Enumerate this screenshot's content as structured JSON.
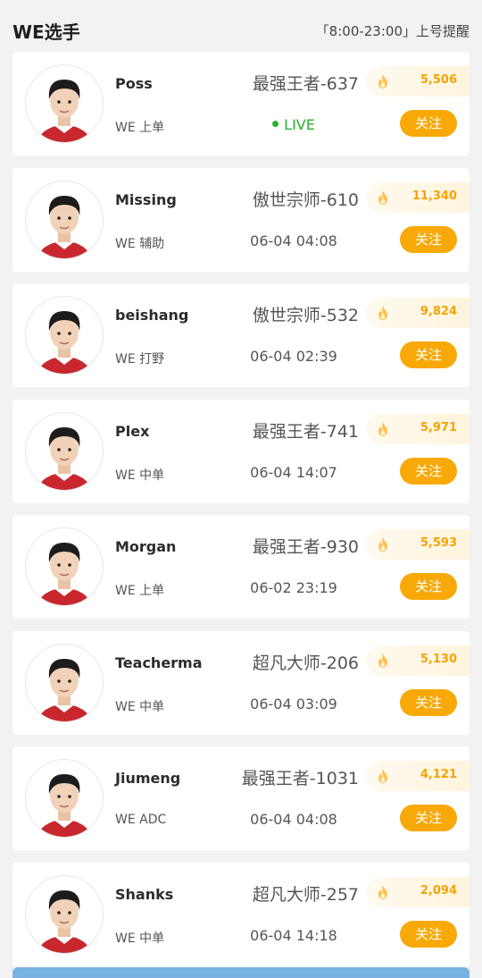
{
  "header": {
    "title": "WE选手",
    "reminder": "「8:00-23:00」上号提醒"
  },
  "colors": {
    "accent": "#f8a908",
    "live": "#27b12c",
    "heat_text": "#f5a300",
    "jersey": "#c8272e",
    "bottom_strip": "#7ab2e3"
  },
  "players": [
    {
      "name": "Poss",
      "team_role": "WE 上单",
      "rank": "最强王者-637",
      "status": "LIVE",
      "live": true,
      "heat": "5,506",
      "follow_label": "关注",
      "avatar_icon": "player-avatar-icon",
      "flame_icon": "flame-icon"
    },
    {
      "name": "Missing",
      "team_role": "WE 辅助",
      "rank": "傲世宗师-610",
      "status": "06-04 04:08",
      "live": false,
      "heat": "11,340",
      "follow_label": "关注",
      "avatar_icon": "player-avatar-icon",
      "flame_icon": "flame-icon"
    },
    {
      "name": "beishang",
      "team_role": "WE 打野",
      "rank": "傲世宗师-532",
      "status": "06-04 02:39",
      "live": false,
      "heat": "9,824",
      "follow_label": "关注",
      "avatar_icon": "player-avatar-icon",
      "flame_icon": "flame-icon"
    },
    {
      "name": "Plex",
      "team_role": "WE 中单",
      "rank": "最强王者-741",
      "status": "06-04 14:07",
      "live": false,
      "heat": "5,971",
      "follow_label": "关注",
      "avatar_icon": "player-avatar-icon",
      "flame_icon": "flame-icon"
    },
    {
      "name": "Morgan",
      "team_role": "WE 上单",
      "rank": "最强王者-930",
      "status": "06-02 23:19",
      "live": false,
      "heat": "5,593",
      "follow_label": "关注",
      "avatar_icon": "player-avatar-icon",
      "flame_icon": "flame-icon"
    },
    {
      "name": "Teacherma",
      "team_role": "WE 中单",
      "rank": "超凡大师-206",
      "status": "06-04 03:09",
      "live": false,
      "heat": "5,130",
      "follow_label": "关注",
      "avatar_icon": "player-avatar-icon",
      "flame_icon": "flame-icon"
    },
    {
      "name": "Jiumeng",
      "team_role": "WE ADC",
      "rank": "最强王者-1031",
      "status": "06-04 04:08",
      "live": false,
      "heat": "4,121",
      "follow_label": "关注",
      "avatar_icon": "player-avatar-icon",
      "flame_icon": "flame-icon"
    },
    {
      "name": "Shanks",
      "team_role": "WE 中单",
      "rank": "超凡大师-257",
      "status": "06-04 14:18",
      "live": false,
      "heat": "2,094",
      "follow_label": "关注",
      "avatar_icon": "player-avatar-icon",
      "flame_icon": "flame-icon"
    }
  ]
}
